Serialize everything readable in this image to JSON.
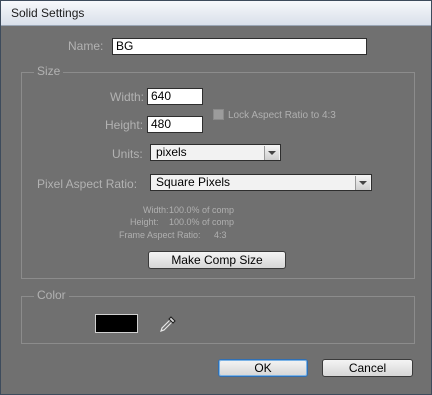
{
  "window": {
    "title": "Solid Settings"
  },
  "name": {
    "label": "Name:",
    "value": "BG"
  },
  "size": {
    "group_label": "Size",
    "width_label": "Width:",
    "width_value": "640",
    "height_label": "Height:",
    "height_value": "480",
    "lock_label": "Lock Aspect Ratio to 4:3",
    "units_label": "Units:",
    "units_value": "pixels",
    "par_label": "Pixel Aspect Ratio:",
    "par_value": "Square Pixels",
    "info": {
      "width_label": "Width:",
      "width_value": "100.0% of comp",
      "height_label": "Height:",
      "height_value": "100.0% of comp",
      "frame_label": "Frame Aspect Ratio:",
      "frame_value": "4:3"
    },
    "make_comp_size": "Make Comp Size"
  },
  "color": {
    "group_label": "Color",
    "swatch": "#000000",
    "eyedropper_icon": "eyedropper-icon"
  },
  "buttons": {
    "ok": "OK",
    "cancel": "Cancel"
  }
}
